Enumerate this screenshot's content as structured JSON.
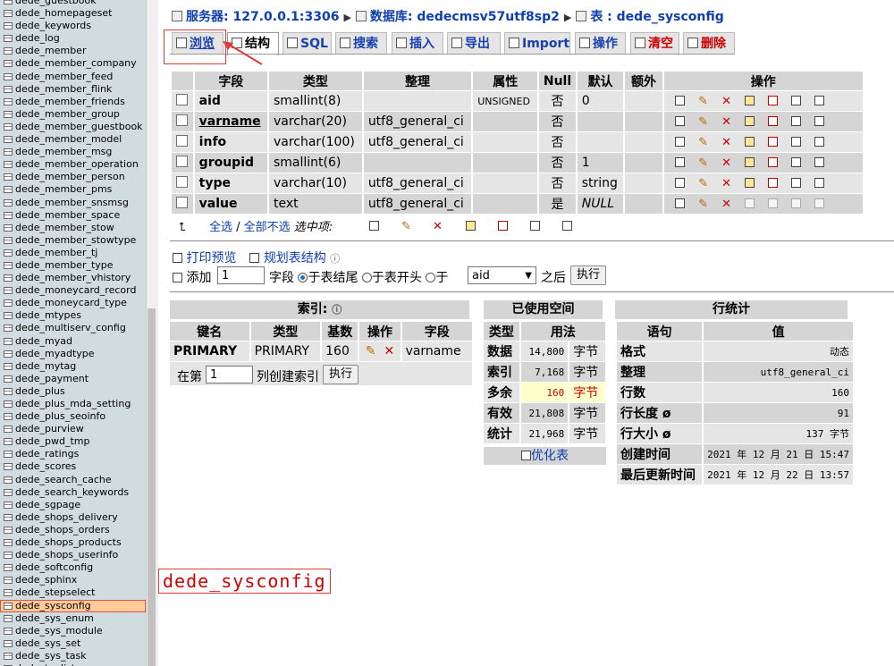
{
  "sidebar": {
    "items": [
      "dede_guestbook",
      "dede_homepageset",
      "dede_keywords",
      "dede_log",
      "dede_member",
      "dede_member_company",
      "dede_member_feed",
      "dede_member_flink",
      "dede_member_friends",
      "dede_member_group",
      "dede_member_guestbook",
      "dede_member_model",
      "dede_member_msg",
      "dede_member_operation",
      "dede_member_person",
      "dede_member_pms",
      "dede_member_snsmsg",
      "dede_member_space",
      "dede_member_stow",
      "dede_member_stowtype",
      "dede_member_tj",
      "dede_member_type",
      "dede_member_vhistory",
      "dede_moneycard_record",
      "dede_moneycard_type",
      "dede_mtypes",
      "dede_multiserv_config",
      "dede_myad",
      "dede_myadtype",
      "dede_mytag",
      "dede_payment",
      "dede_plus",
      "dede_plus_mda_setting",
      "dede_plus_seoinfo",
      "dede_purview",
      "dede_pwd_tmp",
      "dede_ratings",
      "dede_scores",
      "dede_search_cache",
      "dede_search_keywords",
      "dede_sgpage",
      "dede_shops_delivery",
      "dede_shops_orders",
      "dede_shops_products",
      "dede_shops_userinfo",
      "dede_softconfig",
      "dede_sphinx",
      "dede_stepselect",
      "dede_sysconfig",
      "dede_sys_enum",
      "dede_sys_module",
      "dede_sys_set",
      "dede_sys_task",
      "dede_taglist"
    ],
    "active": "dede_sysconfig"
  },
  "breadcrumb": {
    "server": "服务器: 127.0.0.1:3306",
    "database": "数据库: dedecmsv57utf8sp2",
    "table": "表 : dede_sysconfig"
  },
  "tabs": {
    "browse": "浏览",
    "structure": "结构",
    "sql": "SQL",
    "search": "搜索",
    "insert": "插入",
    "export": "导出",
    "import": "Import",
    "operations": "操作",
    "empty": "清空",
    "drop": "删除"
  },
  "structure": {
    "headers": [
      "字段",
      "类型",
      "整理",
      "属性",
      "Null",
      "默认",
      "额外",
      "操作"
    ],
    "rows": [
      {
        "field": "aid",
        "type": "smallint(8)",
        "collation": "",
        "attr": "UNSIGNED",
        "null": "否",
        "default": "0",
        "extra": ""
      },
      {
        "field": "varname",
        "type": "varchar(20)",
        "collation": "utf8_general_ci",
        "attr": "",
        "null": "否",
        "default": "",
        "extra": ""
      },
      {
        "field": "info",
        "type": "varchar(100)",
        "collation": "utf8_general_ci",
        "attr": "",
        "null": "否",
        "default": "",
        "extra": ""
      },
      {
        "field": "groupid",
        "type": "smallint(6)",
        "collation": "",
        "attr": "",
        "null": "否",
        "default": "1",
        "extra": ""
      },
      {
        "field": "type",
        "type": "varchar(10)",
        "collation": "utf8_general_ci",
        "attr": "",
        "null": "否",
        "default": "string",
        "extra": ""
      },
      {
        "field": "value",
        "type": "text",
        "collation": "utf8_general_ci",
        "attr": "",
        "null": "是",
        "default": "NULL",
        "extra": ""
      }
    ]
  },
  "bulk": {
    "check_all": "全选",
    "slash": " / ",
    "uncheck_all": "全部不选",
    "with_selected": "选中项:"
  },
  "tools": {
    "print_view": "打印预览",
    "propose": "规划表结构"
  },
  "add_field": {
    "add_label": "添加",
    "count": "1",
    "field_label": "字段",
    "at_end": "于表结尾",
    "at_start": "于表开头",
    "after_prefix": "于",
    "after_field": "aid",
    "after_suffix": "之后",
    "go": "执行"
  },
  "indexes": {
    "title": "索引:",
    "headers": [
      "键名",
      "类型",
      "基数",
      "操作",
      "字段"
    ],
    "rows": [
      {
        "key": "PRIMARY",
        "type": "PRIMARY",
        "cardinality": "160",
        "column": "varname"
      }
    ],
    "create_prefix": "在第",
    "create_count": "1",
    "create_suffix": "列创建索引",
    "go": "执行"
  },
  "space": {
    "title": "已使用空间",
    "headers": [
      "类型",
      "用法"
    ],
    "rows": [
      {
        "label": "数据",
        "value": "14,800",
        "unit": "字节"
      },
      {
        "label": "索引",
        "value": "7,168",
        "unit": "字节"
      },
      {
        "label": "多余",
        "value": "160",
        "unit": "字节"
      },
      {
        "label": "有效",
        "value": "21,808",
        "unit": "字节"
      },
      {
        "label": "统计",
        "value": "21,968",
        "unit": "字节"
      }
    ],
    "optimize": "优化表"
  },
  "row_stats": {
    "title": "行统计",
    "headers": [
      "语句",
      "值"
    ],
    "rows": [
      {
        "label": "格式",
        "value": "动态"
      },
      {
        "label": "整理",
        "value": "utf8_general_ci"
      },
      {
        "label": "行数",
        "value": "160"
      },
      {
        "label": "行长度 ø",
        "value": "91"
      },
      {
        "label": "行大小 ø",
        "value": "137 字节"
      },
      {
        "label": "创建时间",
        "value": "2021 年 12 月 21 日 15:47"
      },
      {
        "label": "最后更新时间",
        "value": "2021 年 12 月 22 日 13:57"
      }
    ]
  },
  "annotation": "dede_sysconfig",
  "colors": {
    "link": "#0d3faf",
    "highlight": "#e03a3a",
    "sidebar_bg": "#d0dce0",
    "waste_bg": "#ffffcc"
  }
}
